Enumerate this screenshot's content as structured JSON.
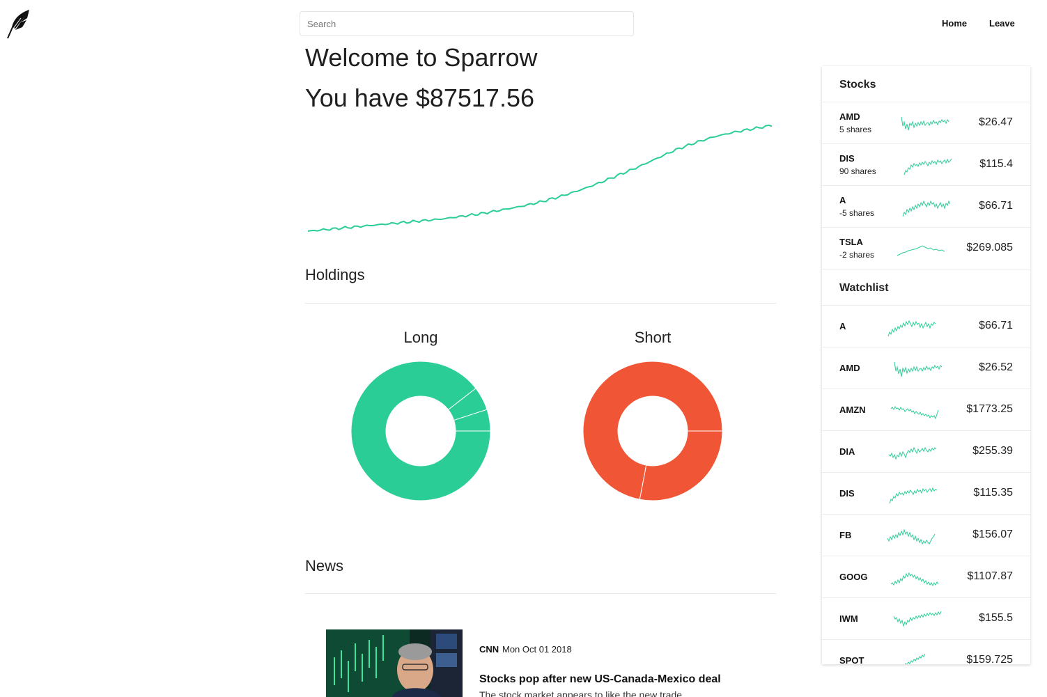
{
  "app": {
    "logo_icon": "quill-feather-icon",
    "accent_color": "#2bcd96",
    "short_color": "#f05536"
  },
  "search": {
    "placeholder": "Search"
  },
  "nav": {
    "home_label": "Home",
    "leave_label": "Leave"
  },
  "main": {
    "welcome_text": "Welcome to Sparrow",
    "balance_text": "You have $87517.56"
  },
  "holdings": {
    "title": "Holdings",
    "long_label": "Long",
    "short_label": "Short"
  },
  "chart_data": [
    {
      "type": "line",
      "title": "",
      "series": [
        {
          "values": [
            28,
            30,
            32,
            34,
            36,
            38,
            40,
            42,
            45,
            48,
            52,
            56,
            61,
            67,
            74,
            82,
            91,
            100,
            110,
            120,
            128,
            135,
            140,
            144,
            148
          ]
        }
      ],
      "grid": false
    },
    {
      "type": "pie",
      "title": "Long",
      "slices": [
        {
          "value": 0.895
        },
        {
          "value": 0.055
        },
        {
          "value": 0.05
        }
      ],
      "color": "#2bcd96"
    },
    {
      "type": "pie",
      "title": "Short",
      "slices": [
        {
          "value": 0.28
        },
        {
          "value": 0.72
        }
      ],
      "color": "#f05536"
    }
  ],
  "news": {
    "title": "News",
    "items": [
      {
        "source": "CNN",
        "date": "Mon Oct 01 2018",
        "headline": "Stocks pop after new US-Canada-Mexico deal",
        "snippet": "The stock market appears to like the new trade"
      }
    ]
  },
  "panel": {
    "stocks_title": "Stocks",
    "stocks": [
      {
        "symbol": "AMD",
        "shares": "5 shares",
        "price": "$26.47"
      },
      {
        "symbol": "DIS",
        "shares": "90 shares",
        "price": "$115.4"
      },
      {
        "symbol": "A",
        "shares": "-5 shares",
        "price": "$66.71"
      },
      {
        "symbol": "TSLA",
        "shares": "-2 shares",
        "price": "$269.085"
      }
    ],
    "watchlist_title": "Watchlist",
    "watchlist": [
      {
        "symbol": "A",
        "price": "$66.71"
      },
      {
        "symbol": "AMD",
        "price": "$26.52"
      },
      {
        "symbol": "AMZN",
        "price": "$1773.25"
      },
      {
        "symbol": "DIA",
        "price": "$255.39"
      },
      {
        "symbol": "DIS",
        "price": "$115.35"
      },
      {
        "symbol": "FB",
        "price": "$156.07"
      },
      {
        "symbol": "GOOG",
        "price": "$1107.87"
      },
      {
        "symbol": "IWM",
        "price": "$155.5"
      },
      {
        "symbol": "SPOT",
        "price": "$159.725"
      }
    ]
  }
}
